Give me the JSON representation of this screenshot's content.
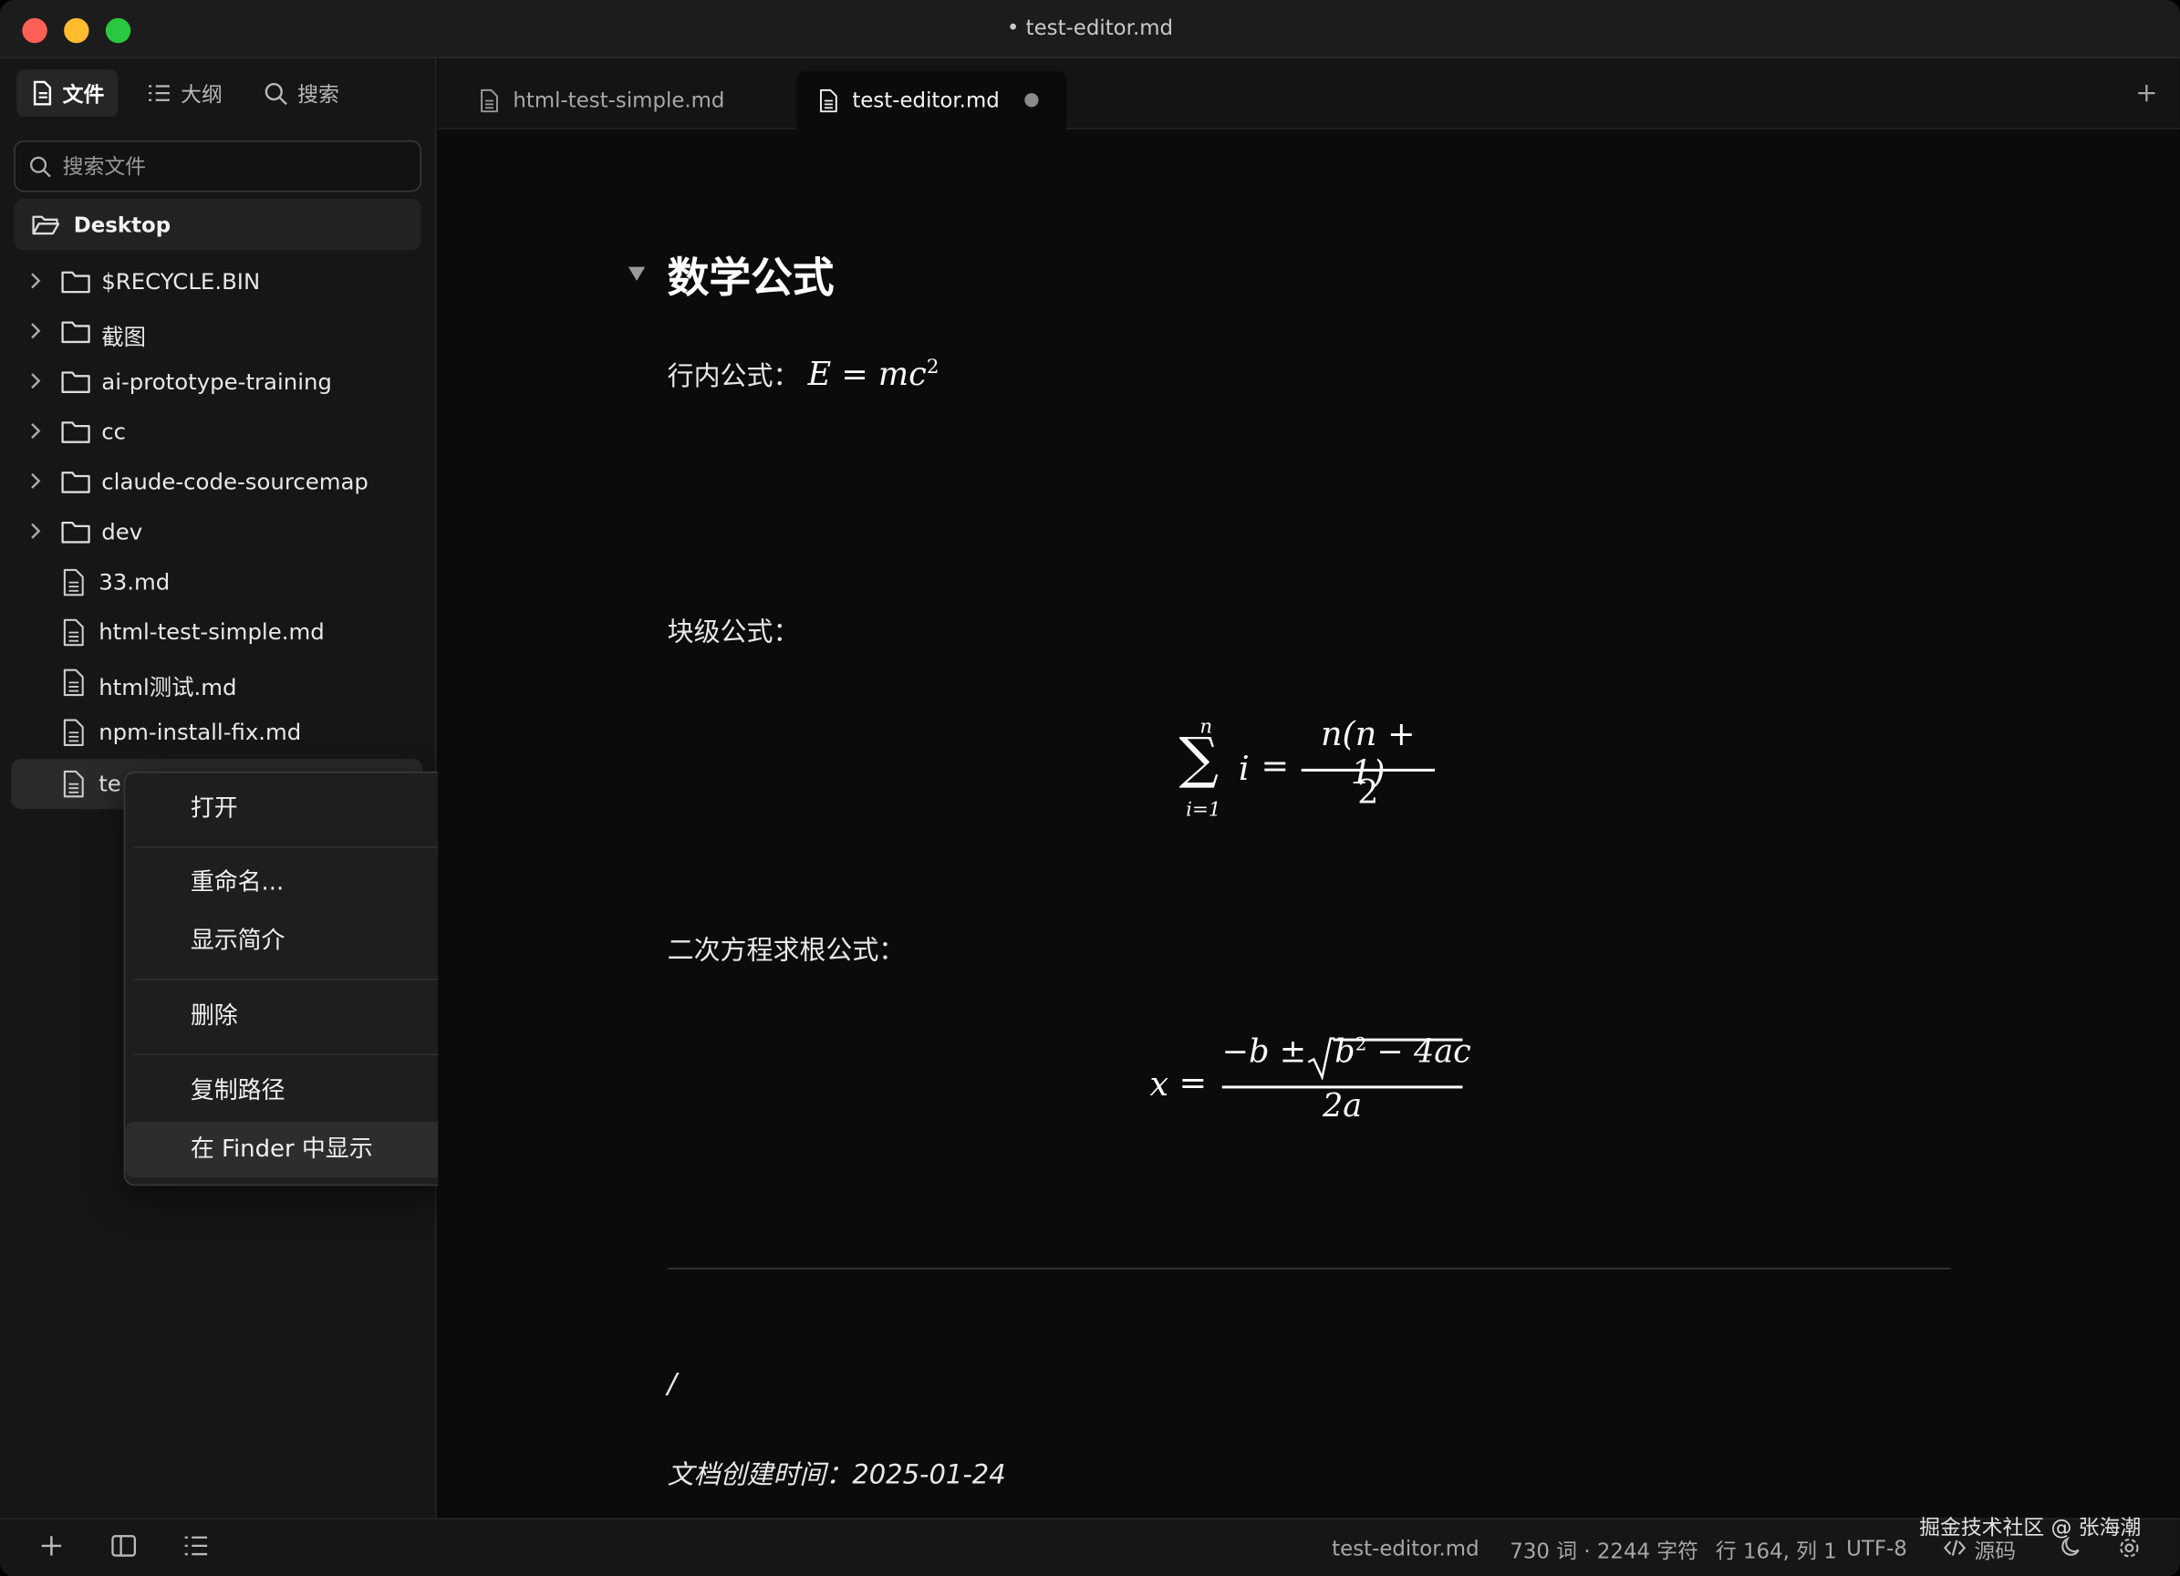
{
  "window": {
    "title": "• test-editor.md"
  },
  "sidebar": {
    "tabs": [
      {
        "label": "文件",
        "icon": "file-icon"
      },
      {
        "label": "大纲",
        "icon": "list-icon"
      },
      {
        "label": "搜索",
        "icon": "search-icon"
      }
    ],
    "search_placeholder": "搜索文件",
    "root_folder": "Desktop",
    "items": [
      {
        "type": "folder",
        "label": "$RECYCLE.BIN"
      },
      {
        "type": "folder",
        "label": "截图"
      },
      {
        "type": "folder",
        "label": "ai-prototype-training"
      },
      {
        "type": "folder",
        "label": "cc"
      },
      {
        "type": "folder",
        "label": "claude-code-sourcemap"
      },
      {
        "type": "folder",
        "label": "dev"
      },
      {
        "type": "file",
        "label": "33.md"
      },
      {
        "type": "file",
        "label": "html-test-simple.md"
      },
      {
        "type": "file",
        "label": "html测试.md"
      },
      {
        "type": "file",
        "label": "npm-install-fix.md"
      },
      {
        "type": "file",
        "label": "te",
        "selected": true
      }
    ]
  },
  "context_menu": {
    "items": [
      {
        "label": "打开"
      },
      {
        "label": "重命名..."
      },
      {
        "label": "显示简介"
      },
      {
        "label": "删除"
      },
      {
        "label": "复制路径"
      },
      {
        "label": "在 Finder 中显示",
        "highlighted": true
      }
    ]
  },
  "tabs": [
    {
      "label": "html-test-simple.md",
      "active": false
    },
    {
      "label": "test-editor.md",
      "active": true,
      "modified": true
    }
  ],
  "editor": {
    "heading": "数学公式",
    "inline_label": "行内公式：",
    "block_label": "块级公式：",
    "quadratic_label": "二次方程求根公式：",
    "cursor_char": "/",
    "created": "文档创建时间：2025-01-24",
    "math": {
      "inline_E": "E",
      "inline_eq": "=",
      "inline_mc": "mc",
      "inline_sup": "2",
      "sum_top": "n",
      "sum_sym": "∑",
      "sum_bottom": "i=1",
      "sum_i": "i",
      "sum_eq": "=",
      "sum_num": "n(n + 1)",
      "sum_den": "2",
      "q_x": "x",
      "q_eq": "=",
      "q_num_pre": "−b ±",
      "q_root_b": "b",
      "q_root_sup": "2",
      "q_root_rest": " − 4ac",
      "q_den": "2a"
    }
  },
  "statusbar": {
    "filename": "test-editor.md",
    "stats": "730 词 · 2244 字符",
    "position": "行 164, 列 1",
    "encoding": "UTF-8",
    "source_label": "源码",
    "watermark": "掘金技术社区 @ 张海潮"
  }
}
